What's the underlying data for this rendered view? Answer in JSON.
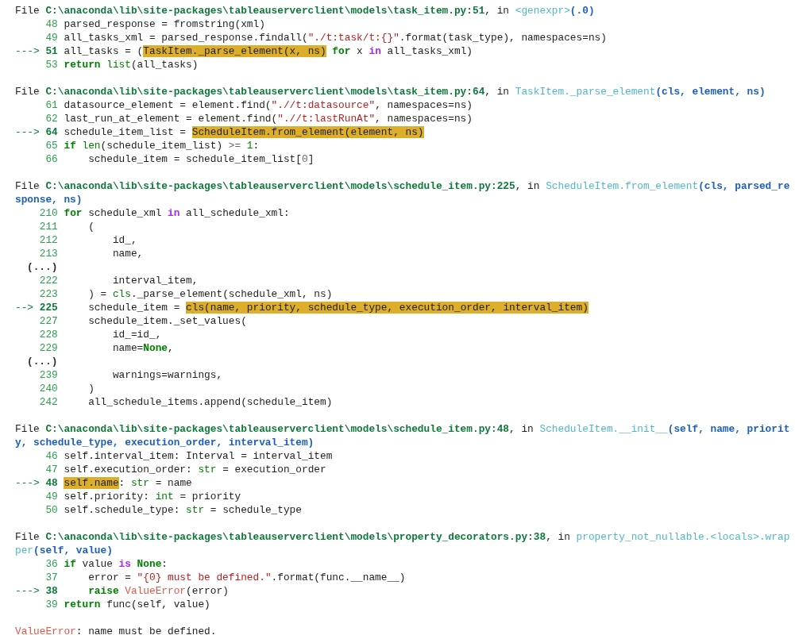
{
  "frames": [
    {
      "path": "C:\\anaconda\\lib\\site-packages\\tableauserverclient\\models\\task_item.py:51",
      "file_label": "File",
      "in_label": ", in",
      "function": "<genexpr>",
      "args": "(.0)",
      "lines": [
        {
          "number": "48",
          "segments": [
            {
              "kind": "plain",
              "text": "parsed_response = fromstring(xml)"
            }
          ]
        },
        {
          "number": "49",
          "segments": [
            {
              "kind": "plain",
              "text": "all_tasks_xml = parsed_response.findall("
            },
            {
              "kind": "string",
              "text": "\"./t:task/t:{}\""
            },
            {
              "kind": "plain",
              "text": ".format(task_type), namespaces=ns)"
            }
          ]
        },
        {
          "number": "51",
          "arrow": "--->",
          "segments": [
            {
              "kind": "plain",
              "text": "all_tasks = ("
            },
            {
              "kind": "highlight",
              "text": "TaskItem._parse_element(x, ns)"
            },
            {
              "kind": "keyword",
              "text": " for"
            },
            {
              "kind": "plain",
              "text": " x "
            },
            {
              "kind": "operator_word",
              "text": "in"
            },
            {
              "kind": "plain",
              "text": " all_tasks_xml)"
            }
          ]
        },
        {
          "number": "53",
          "segments": [
            {
              "kind": "keyword",
              "text": "return "
            },
            {
              "kind": "builtin",
              "text": "list"
            },
            {
              "kind": "plain",
              "text": "(all_tasks)"
            }
          ]
        }
      ]
    },
    {
      "path": "C:\\anaconda\\lib\\site-packages\\tableauserverclient\\models\\task_item.py:64",
      "file_label": "File",
      "in_label": ", in",
      "function": "TaskItem._parse_element",
      "args": "(cls, element, ns)",
      "lines": [
        {
          "number": "61",
          "segments": [
            {
              "kind": "plain",
              "text": "datasource_element = element.find("
            },
            {
              "kind": "string",
              "text": "\".//t:datasource\""
            },
            {
              "kind": "plain",
              "text": ", namespaces=ns)"
            }
          ]
        },
        {
          "number": "62",
          "segments": [
            {
              "kind": "plain",
              "text": "last_run_at_element = element.find("
            },
            {
              "kind": "string",
              "text": "\".//t:lastRunAt\""
            },
            {
              "kind": "plain",
              "text": ", namespaces=ns)"
            }
          ]
        },
        {
          "number": "64",
          "arrow": "--->",
          "segments": [
            {
              "kind": "plain",
              "text": "schedule_item_list = "
            },
            {
              "kind": "highlight",
              "text": "ScheduleItem.from_element(element, ns)"
            }
          ]
        },
        {
          "number": "65",
          "segments": [
            {
              "kind": "keyword",
              "text": "if "
            },
            {
              "kind": "builtin",
              "text": "len"
            },
            {
              "kind": "plain",
              "text": "(schedule_item_list) "
            },
            {
              "kind": "operator",
              "text": ">="
            },
            {
              "kind": "number",
              "text": " 1"
            },
            {
              "kind": "plain",
              "text": ":"
            }
          ]
        },
        {
          "number": "66",
          "segments": [
            {
              "kind": "plain",
              "text": "    schedule_item = schedule_item_list["
            },
            {
              "kind": "operator",
              "text": "0"
            },
            {
              "kind": "plain",
              "text": "]"
            }
          ]
        }
      ]
    },
    {
      "path": "C:\\anaconda\\lib\\site-packages\\tableauserverclient\\models\\schedule_item.py:225",
      "file_label": "File",
      "in_label": ", in",
      "function": "ScheduleItem.from_element",
      "args": "(cls, parsed_response, ns)",
      "lines": [
        {
          "number": "210",
          "segments": [
            {
              "kind": "keyword",
              "text": "for"
            },
            {
              "kind": "plain",
              "text": " schedule_xml "
            },
            {
              "kind": "operator_word",
              "text": "in"
            },
            {
              "kind": "plain",
              "text": " all_schedule_xml:"
            }
          ]
        },
        {
          "number": "211",
          "segments": [
            {
              "kind": "plain",
              "text": "    ("
            }
          ]
        },
        {
          "number": "212",
          "segments": [
            {
              "kind": "plain",
              "text": "        id_,"
            }
          ]
        },
        {
          "number": "213",
          "segments": [
            {
              "kind": "plain",
              "text": "        name,"
            }
          ]
        },
        {
          "ellipsis": "(...)"
        },
        {
          "number": "222",
          "segments": [
            {
              "kind": "plain",
              "text": "        interval_item,"
            }
          ]
        },
        {
          "number": "223",
          "segments": [
            {
              "kind": "plain",
              "text": "    ) = "
            },
            {
              "kind": "builtin",
              "text": "cls"
            },
            {
              "kind": "plain",
              "text": "._parse_element(schedule_xml, ns)"
            }
          ]
        },
        {
          "number": "225",
          "arrow": "-->",
          "segments": [
            {
              "kind": "plain",
              "text": "    schedule_item = "
            },
            {
              "kind": "highlight",
              "text": "cls(name, priority, schedule_type, execution_order, interval_item)"
            }
          ]
        },
        {
          "number": "227",
          "segments": [
            {
              "kind": "plain",
              "text": "    schedule_item._set_values("
            }
          ]
        },
        {
          "number": "228",
          "segments": [
            {
              "kind": "plain",
              "text": "        id_=id_,"
            }
          ]
        },
        {
          "number": "229",
          "segments": [
            {
              "kind": "plain",
              "text": "        name="
            },
            {
              "kind": "keyword",
              "text": "None"
            },
            {
              "kind": "plain",
              "text": ","
            }
          ]
        },
        {
          "ellipsis": "(...)"
        },
        {
          "number": "239",
          "segments": [
            {
              "kind": "plain",
              "text": "        warnings=warnings,"
            }
          ]
        },
        {
          "number": "240",
          "segments": [
            {
              "kind": "plain",
              "text": "    )"
            }
          ]
        },
        {
          "number": "242",
          "segments": [
            {
              "kind": "plain",
              "text": "    all_schedule_items.append(schedule_item)"
            }
          ]
        }
      ]
    },
    {
      "path": "C:\\anaconda\\lib\\site-packages\\tableauserverclient\\models\\schedule_item.py:48",
      "file_label": "File",
      "in_label": ", in",
      "function": "ScheduleItem.__init__",
      "args": "(self, name, priority, schedule_type, execution_order, interval_item)",
      "lines": [
        {
          "number": "46",
          "segments": [
            {
              "kind": "plain",
              "text": "self.interval_item: Interval = interval_item"
            }
          ]
        },
        {
          "number": "47",
          "segments": [
            {
              "kind": "plain",
              "text": "self.execution_order: "
            },
            {
              "kind": "builtin",
              "text": "str"
            },
            {
              "kind": "plain",
              "text": " = execution_order"
            }
          ]
        },
        {
          "number": "48",
          "arrow": "--->",
          "segments": [
            {
              "kind": "highlight",
              "text": "self.name"
            },
            {
              "kind": "plain",
              "text": ": "
            },
            {
              "kind": "builtin",
              "text": "str"
            },
            {
              "kind": "plain",
              "text": " = name"
            }
          ]
        },
        {
          "number": "49",
          "segments": [
            {
              "kind": "plain",
              "text": "self.priority: "
            },
            {
              "kind": "builtin",
              "text": "int"
            },
            {
              "kind": "plain",
              "text": " = priority"
            }
          ]
        },
        {
          "number": "50",
          "segments": [
            {
              "kind": "plain",
              "text": "self.schedule_type: "
            },
            {
              "kind": "builtin",
              "text": "str"
            },
            {
              "kind": "plain",
              "text": " = schedule_type"
            }
          ]
        }
      ]
    },
    {
      "path": "C:\\anaconda\\lib\\site-packages\\tableauserverclient\\models\\property_decorators.py:38",
      "file_label": "File",
      "in_label": ", in",
      "function": "property_not_nullable.<locals>.wrapper",
      "args": "(self, value)",
      "lines": [
        {
          "number": "36",
          "segments": [
            {
              "kind": "keyword",
              "text": "if"
            },
            {
              "kind": "plain",
              "text": " value "
            },
            {
              "kind": "operator_word",
              "text": "is"
            },
            {
              "kind": "keyword",
              "text": " None"
            },
            {
              "kind": "plain",
              "text": ":"
            }
          ]
        },
        {
          "number": "37",
          "segments": [
            {
              "kind": "plain",
              "text": "    error = "
            },
            {
              "kind": "string",
              "text": "\"{0} must be defined.\""
            },
            {
              "kind": "plain",
              "text": ".format(func.__name__)"
            }
          ]
        },
        {
          "number": "38",
          "arrow": "--->",
          "segments": [
            {
              "kind": "keyword",
              "text": "    raise"
            },
            {
              "kind": "error_name",
              "text": " ValueError"
            },
            {
              "kind": "plain",
              "text": "(error)"
            }
          ]
        },
        {
          "number": "39",
          "segments": [
            {
              "kind": "keyword",
              "text": "return"
            },
            {
              "kind": "plain",
              "text": " func(self, value)"
            }
          ]
        }
      ]
    }
  ],
  "error": {
    "exception": "ValueError",
    "message": ": name must be defined."
  }
}
